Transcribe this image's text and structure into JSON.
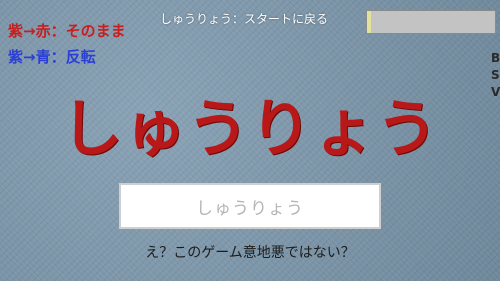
{
  "hints": {
    "red_rule": "紫→赤：そのまま",
    "blue_rule": "紫→青：反転"
  },
  "header": {
    "caption": "しゅうりょう：スタートに戻る",
    "meter_level": 0.03
  },
  "side_letters": [
    "B",
    "S",
    "V"
  ],
  "main_word": "しゅうりょう",
  "answer": {
    "text": "しゅうりょう"
  },
  "footer": {
    "caption": "え？このゲーム意地悪ではない？"
  },
  "colors": {
    "red": "#c81e1e",
    "blue": "#2b3fd6",
    "main_word": "#b81818"
  }
}
